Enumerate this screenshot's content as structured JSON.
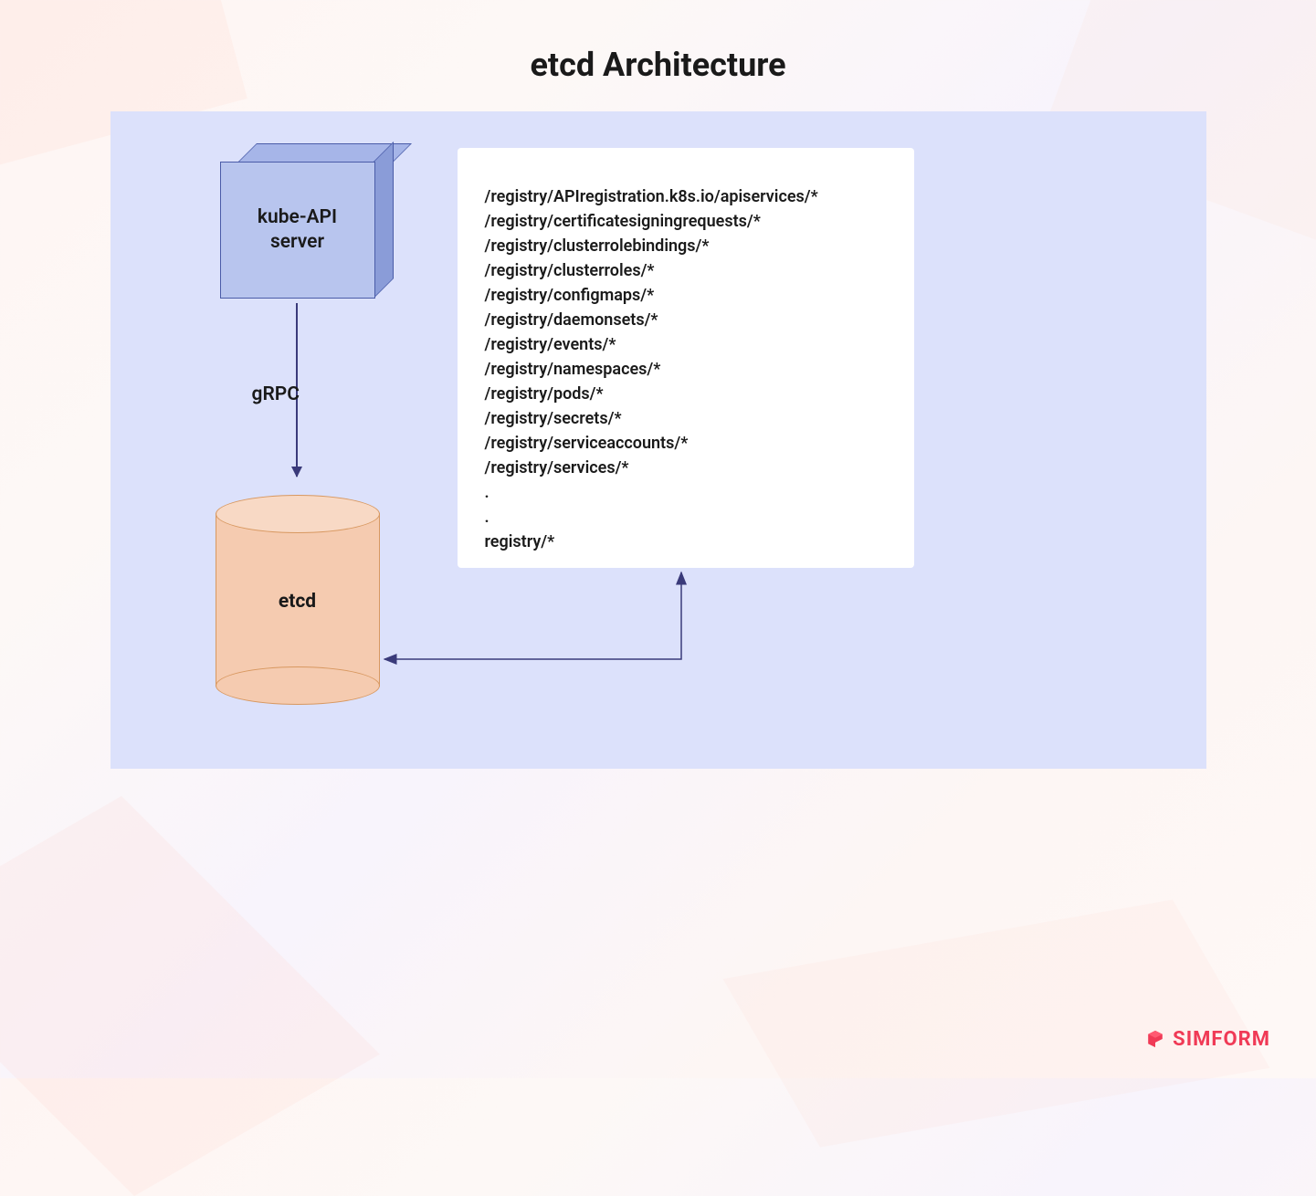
{
  "title": "etcd Architecture",
  "kube_api": {
    "label_line1": "kube-API",
    "label_line2": "server"
  },
  "connection_label": "gRPC",
  "etcd_label": "etcd",
  "registry_paths": [
    "/registry/APIregistration.k8s.io/apiservices/*",
    "/registry/certificatesigningrequests/*",
    "/registry/clusterrolebindings/*",
    "/registry/clusterroles/*",
    "/registry/configmaps/*",
    "/registry/daemonsets/*",
    "/registry/events/*",
    "/registry/namespaces/*",
    "/registry/pods/*",
    "/registry/secrets/*",
    "/registry/serviceaccounts/*",
    "/registry/services/*",
    ".",
    ".",
    "registry/*"
  ],
  "brand": "SIMFORM"
}
